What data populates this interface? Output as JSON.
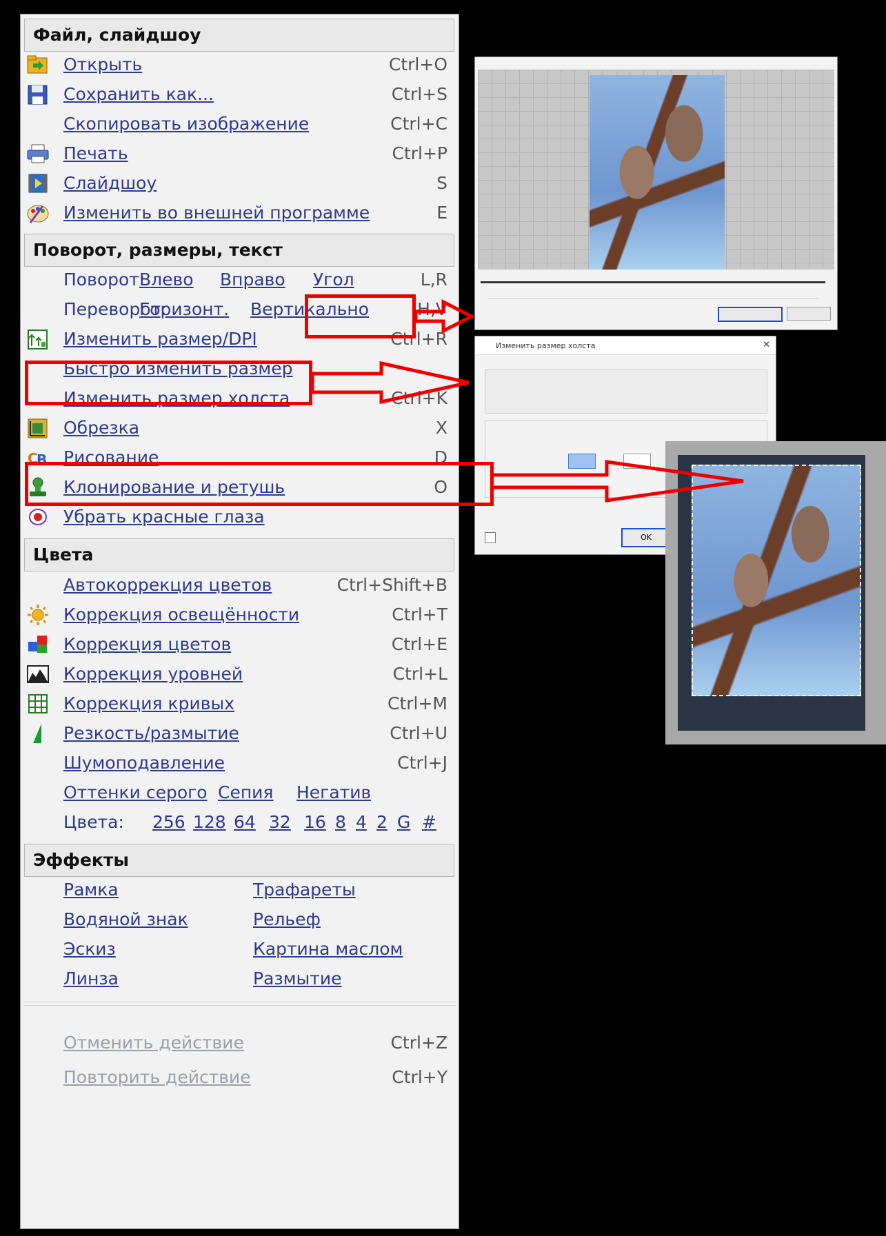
{
  "sections": {
    "file": "Файл, слайдшоу",
    "rotate": "Поворот, размеры, текст",
    "colors": "Цвета",
    "effects": "Эффекты"
  },
  "file_items": [
    {
      "label": "Открыть",
      "shortcut": "Ctrl+O",
      "icon": "folder-open-icon"
    },
    {
      "label": "Сохранить как...",
      "shortcut": "Ctrl+S",
      "icon": "floppy-disk-icon"
    },
    {
      "label": "Скопировать изображение",
      "shortcut": "Ctrl+C"
    },
    {
      "label": "Печать",
      "shortcut": "Ctrl+P",
      "icon": "printer-icon"
    },
    {
      "label": "Слайдшоу",
      "shortcut": "S",
      "icon": "slideshow-icon"
    },
    {
      "label": "Изменить во внешней программе",
      "shortcut": "E",
      "icon": "palette-icon"
    }
  ],
  "rotate": {
    "label": "Поворот:",
    "left": "Влево",
    "right": "Вправо",
    "angle": "Угол",
    "shortcut": "L,R"
  },
  "flip": {
    "label": "Переворот:",
    "horizontal": "Горизонт.",
    "vertical": "Вертикально",
    "shortcut": "H,V"
  },
  "resize_items": [
    {
      "label": "Изменить размер/DPI",
      "shortcut": "Ctrl+R",
      "icon": "resize-icon"
    },
    {
      "label": "Быстро изменить размер",
      "shortcut": ""
    },
    {
      "label": "Изменить размер холста",
      "shortcut": "Ctrl+K"
    },
    {
      "label": "Обрезка",
      "shortcut": "X",
      "icon": "crop-icon"
    },
    {
      "label": "Рисование",
      "shortcut": "D",
      "icon": "drawing-icon"
    },
    {
      "label": "Клонирование и ретушь",
      "shortcut": "O",
      "icon": "clone-stamp-icon"
    },
    {
      "label": "Убрать красные глаза",
      "shortcut": "",
      "icon": "red-eye-icon"
    }
  ],
  "color_items": [
    {
      "label": "Автокоррекция цветов",
      "shortcut": "Ctrl+Shift+B"
    },
    {
      "label": "Коррекция освещённости",
      "shortcut": "Ctrl+T",
      "icon": "sun-icon"
    },
    {
      "label": "Коррекция цветов",
      "shortcut": "Ctrl+E",
      "icon": "color-blocks-icon"
    },
    {
      "label": "Коррекция уровней",
      "shortcut": "Ctrl+L",
      "icon": "histogram-icon"
    },
    {
      "label": "Коррекция кривых",
      "shortcut": "Ctrl+M",
      "icon": "curves-grid-icon"
    },
    {
      "label": "Резкость/размытие",
      "shortcut": "Ctrl+U",
      "icon": "sharpen-icon"
    },
    {
      "label": "Шумоподавление",
      "shortcut": "Ctrl+J"
    }
  ],
  "tones": {
    "gray": "Оттенки серого",
    "sepia": "Сепия",
    "negative": "Негатив"
  },
  "color_depth": {
    "label": "Цвета:",
    "options": [
      "256",
      "128",
      "64",
      "32",
      "16",
      "8",
      "4",
      "2",
      "G",
      "#"
    ]
  },
  "effects": [
    [
      "Рамка",
      "Трафареты"
    ],
    [
      "Водяной знак",
      "Рельеф"
    ],
    [
      "Эскиз",
      "Картина маслом"
    ],
    [
      "Линза",
      "Размытие"
    ]
  ],
  "history": [
    {
      "label": "Отменить действие",
      "shortcut": "Ctrl+Z"
    },
    {
      "label": "Повторить действие",
      "shortcut": "Ctrl+Y"
    }
  ],
  "canvas_dialog": {
    "title": "Изменить размер холста",
    "ok": "OK"
  },
  "colors": {
    "accent": "#2e3b8c",
    "annotation": "#ee0000",
    "menu_bg": "#f2f2f2"
  }
}
